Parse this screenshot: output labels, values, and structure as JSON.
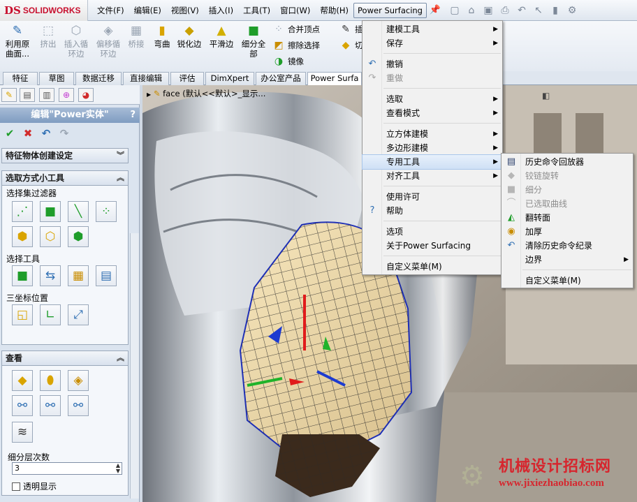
{
  "app": {
    "logo_ds": "DS",
    "logo_text": "SOLIDWORKS"
  },
  "menubar": [
    {
      "label": "文件(F)"
    },
    {
      "label": "编辑(E)"
    },
    {
      "label": "视图(V)"
    },
    {
      "label": "插入(I)"
    },
    {
      "label": "工具(T)"
    },
    {
      "label": "窗口(W)"
    },
    {
      "label": "帮助(H)"
    },
    {
      "label": "Power Surfacing"
    }
  ],
  "toolbar": [
    {
      "label": "利用原\n曲面...",
      "icon": "pencil-surface-icon"
    },
    {
      "label": "挤出",
      "icon": "extrude-icon"
    },
    {
      "label": "插入循\n环边",
      "icon": "insert-loop-icon"
    },
    {
      "label": "偏移循\n环边",
      "icon": "offset-loop-icon"
    },
    {
      "label": "桥接",
      "icon": "bridge-icon"
    },
    {
      "label": "弯曲",
      "icon": "bend-icon"
    },
    {
      "label": "锐化边",
      "icon": "sharpen-edge-icon"
    },
    {
      "label": "平滑边",
      "icon": "smooth-edge-icon"
    },
    {
      "label": "细分全\n部",
      "icon": "subdivide-all-icon"
    },
    {
      "label": "合并顶点",
      "icon": "merge-vertex-icon"
    },
    {
      "label": "擦除选择",
      "icon": "erase-selection-icon"
    },
    {
      "label": "镜像",
      "icon": "mirror-icon"
    },
    {
      "label": "插",
      "icon": "insert-icon"
    },
    {
      "label": "切",
      "icon": "cut-icon"
    }
  ],
  "tabs": [
    {
      "label": "特征"
    },
    {
      "label": "草图"
    },
    {
      "label": "数据迁移"
    },
    {
      "label": "直接编辑"
    },
    {
      "label": "评估"
    },
    {
      "label": "DimXpert"
    },
    {
      "label": "办公室产品"
    },
    {
      "label": "Power Surfa"
    }
  ],
  "panel": {
    "title": "编辑\"Power实体\"",
    "help": "?",
    "groups": {
      "feature_settings": "特征物体创建设定",
      "selection_tools": "选取方式小工具",
      "view": "查看"
    },
    "labels": {
      "filter": "选择集过滤器",
      "select_tools": "选择工具",
      "triad": "三坐标位置",
      "subdiv": "细分层次数",
      "transparent": "透明显示"
    },
    "subdiv_value": "3"
  },
  "viewport": {
    "crumb_label": "face",
    "crumb_config": "(默认<<默认>_显示..."
  },
  "menu_main": [
    {
      "label": "建模工具",
      "submenu": true
    },
    {
      "label": "保存",
      "submenu": true
    },
    {
      "label": "撤销",
      "icon": "undo-icon"
    },
    {
      "label": "重做",
      "icon": "redo-icon",
      "disabled": true
    },
    {
      "label": "选取",
      "submenu": true
    },
    {
      "label": "查看模式",
      "submenu": true
    },
    {
      "label": "立方体建模",
      "submenu": true
    },
    {
      "label": "多边形建模",
      "submenu": true
    },
    {
      "label": "专用工具",
      "submenu": true,
      "highlight": true
    },
    {
      "label": "对齐工具",
      "submenu": true
    },
    {
      "label": "使用许可"
    },
    {
      "label": "帮助",
      "icon": "help-icon"
    },
    {
      "label": "选项"
    },
    {
      "label": "关于Power Surfacing"
    },
    {
      "label": "自定义菜单(M)"
    }
  ],
  "menu_sub": [
    {
      "label": "历史命令回放器",
      "icon": "history-player-icon"
    },
    {
      "label": "铰链旋转",
      "icon": "hinge-rotate-icon",
      "disabled": true
    },
    {
      "label": "细分",
      "icon": "subdivide-icon",
      "disabled": true
    },
    {
      "label": "已选取曲线",
      "icon": "selected-curve-icon",
      "disabled": true
    },
    {
      "label": "翻转面",
      "icon": "flip-face-icon"
    },
    {
      "label": "加厚",
      "icon": "thicken-icon"
    },
    {
      "label": "清除历史命令纪录",
      "icon": "clear-history-icon"
    },
    {
      "label": "边界",
      "submenu": true
    },
    {
      "label": "自定义菜单(M)"
    }
  ],
  "watermark": {
    "cn": "机械设计招标网",
    "url": "www.jixiezhaobiao.com"
  },
  "colors": {
    "accent": "#c8102e",
    "panel_title": "#7f9cc1",
    "highlight": "#cfe0f5"
  }
}
